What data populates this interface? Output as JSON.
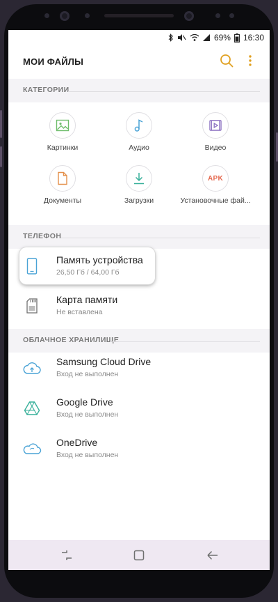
{
  "status": {
    "battery": "69%",
    "time": "16:30"
  },
  "appbar": {
    "title": "МОИ ФАЙЛЫ"
  },
  "icons": {
    "search": "search-icon",
    "more": "more-vertical-icon",
    "accent": "#e0a020"
  },
  "categories": {
    "header": "КАТЕГОРИИ",
    "items": [
      {
        "label": "Картинки",
        "icon": "image-icon",
        "color": "#6fbd6c"
      },
      {
        "label": "Аудио",
        "icon": "music-note-icon",
        "color": "#4aa3d6"
      },
      {
        "label": "Видео",
        "icon": "video-icon",
        "color": "#8a6fc0"
      },
      {
        "label": "Документы",
        "icon": "document-icon",
        "color": "#e4904a"
      },
      {
        "label": "Загрузки",
        "icon": "download-icon",
        "color": "#37b09a"
      },
      {
        "label": "Установочные фай...",
        "icon": "apk-icon",
        "apk_text": "APK",
        "color": "#e56a50"
      }
    ]
  },
  "phone": {
    "header": "ТЕЛЕФОН",
    "items": [
      {
        "title": "Память устройства",
        "subtitle": "26,50 Гб / 64,00 Гб",
        "icon": "smartphone-icon"
      },
      {
        "title": "Карта памяти",
        "subtitle": "Не вставлена",
        "icon": "sd-card-icon"
      }
    ]
  },
  "cloud": {
    "header": "ОБЛАЧНОЕ ХРАНИЛИЩЕ",
    "items": [
      {
        "title": "Samsung Cloud Drive",
        "subtitle": "Вход не выполнен",
        "icon": "cloud-upload-icon"
      },
      {
        "title": "Google Drive",
        "subtitle": "Вход не выполнен",
        "icon": "google-drive-icon"
      },
      {
        "title": "OneDrive",
        "subtitle": "Вход не выполнен",
        "icon": "onedrive-icon"
      }
    ]
  }
}
